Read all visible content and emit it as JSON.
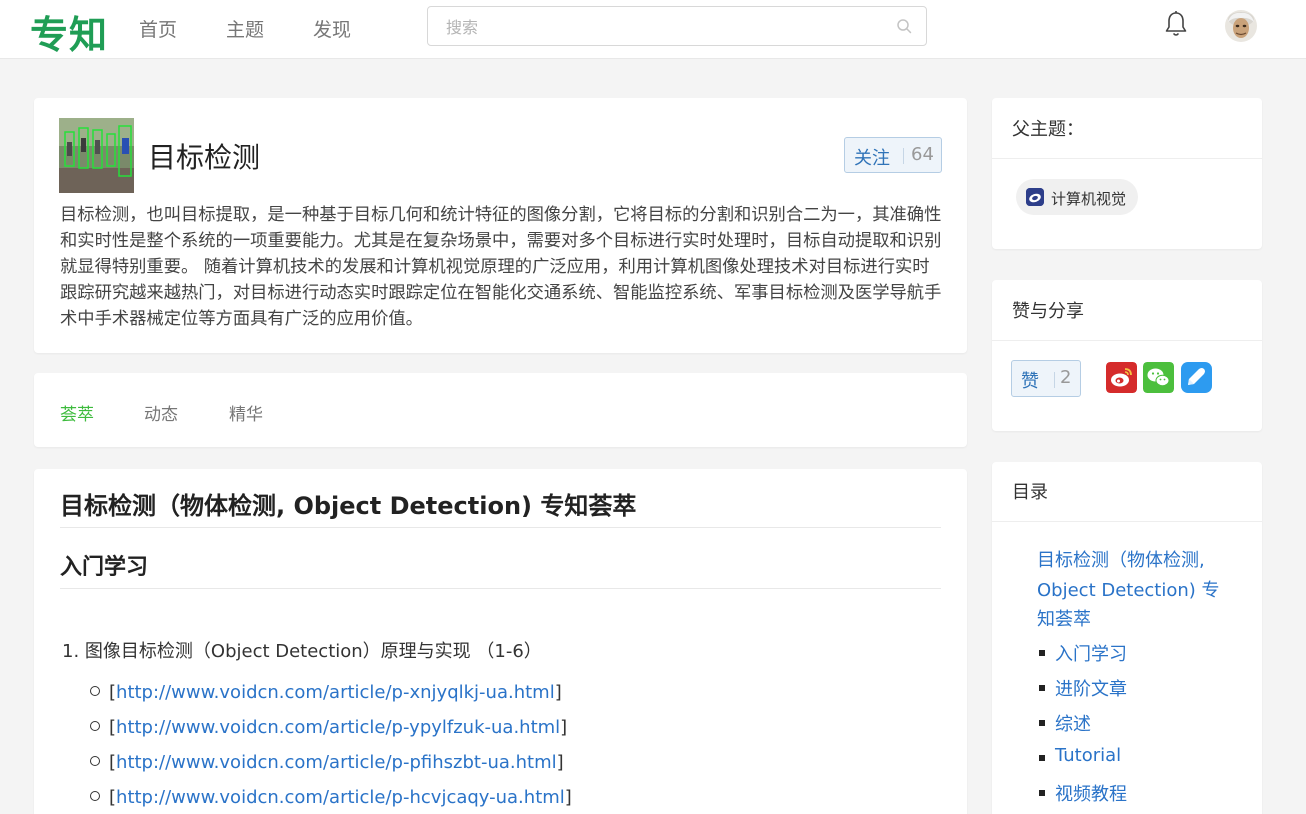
{
  "header": {
    "logo": "专知",
    "nav": [
      "首页",
      "主题",
      "发现"
    ],
    "search_placeholder": "搜索"
  },
  "topic": {
    "title": "目标检测",
    "follow_label": "关注",
    "follow_count": "64",
    "description": "目标检测，也叫目标提取，是一种基于目标几何和统计特征的图像分割，它将目标的分割和识别合二为一，其准确性和实时性是整个系统的一项重要能力。尤其是在复杂场景中，需要对多个目标进行实时处理时，目标自动提取和识别就显得特别重要。 随着计算机技术的发展和计算机视觉原理的广泛应用，利用计算机图像处理技术对目标进行实时跟踪研究越来越热门，对目标进行动态实时跟踪定位在智能化交通系统、智能监控系统、军事目标检测及医学导航手术中手术器械定位等方面具有广泛的应用价值。"
  },
  "tabs": [
    "荟萃",
    "动态",
    "精华"
  ],
  "content": {
    "title": "目标检测（物体检测, Object Detection) 专知荟萃",
    "section": "入门学习",
    "item_1": "1. 图像目标检测（Object Detection）原理与实现 （1-6）",
    "links": [
      "http://www.voidcn.com/article/p-xnjyqlkj-ua.html",
      "http://www.voidcn.com/article/p-ypylfzuk-ua.html",
      "http://www.voidcn.com/article/p-pfihszbt-ua.html",
      "http://www.voidcn.com/article/p-hcvjcaqy-ua.html"
    ]
  },
  "sidebar": {
    "parent_heading": "父主题：",
    "parent_topic": "计算机视觉",
    "share_heading": "赞与分享",
    "like_label": "赞",
    "like_count": "2",
    "share_icons": [
      "weibo-icon",
      "wechat-icon",
      "qq-icon"
    ],
    "toc_heading": "目录",
    "toc_main": "目标检测（物体检测, Object Detection) 专知荟萃",
    "toc_items": [
      "入门学习",
      "进阶文章",
      "综述",
      "Tutorial",
      "视频教程"
    ]
  },
  "colors": {
    "brand_green": "#1f9d55",
    "active_tab": "#3dbb3d",
    "link_blue": "#2a73c8",
    "weibo_red": "#d52b2b",
    "wechat_green": "#4cbf3d",
    "qq_blue": "#2d9bf0"
  }
}
